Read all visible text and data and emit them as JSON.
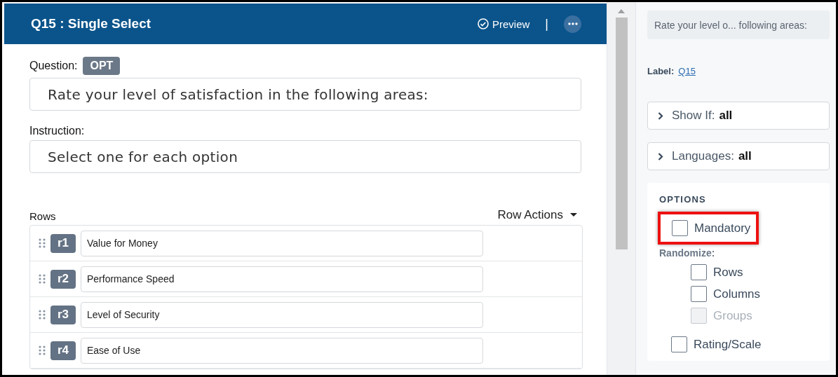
{
  "editor": {
    "title": "Q15 : Single Select",
    "preview": "Preview",
    "separator": "|",
    "question_label": "Question:",
    "question_badge": "OPT",
    "question_text": "Rate your level of satisfaction in the following areas:",
    "instruction_label": "Instruction:",
    "instruction_text": "Select one for each option",
    "rows_label": "Rows",
    "row_actions": "Row Actions",
    "rows": [
      {
        "code": "r1",
        "text": "Value for Money"
      },
      {
        "code": "r2",
        "text": "Performance Speed"
      },
      {
        "code": "r3",
        "text": "Level of Security"
      },
      {
        "code": "r4",
        "text": "Ease of Use"
      }
    ]
  },
  "sidebar": {
    "summary": "Rate your level o... following areas:",
    "label_key": "Label:",
    "label_value": "Q15",
    "sections": [
      {
        "label": "Show If:",
        "value": "all",
        "expanded": false
      },
      {
        "label": "Languages:",
        "value": "all",
        "expanded": false
      }
    ],
    "options": {
      "heading": "OPTIONS",
      "mandatory": {
        "label": "Mandatory",
        "checked": false,
        "highlighted": true
      },
      "randomize_label": "Randomize:",
      "randomize": [
        {
          "label": "Rows",
          "checked": false,
          "disabled": false
        },
        {
          "label": "Columns",
          "checked": false,
          "disabled": false
        },
        {
          "label": "Groups",
          "checked": false,
          "disabled": true
        }
      ],
      "rating": {
        "label": "Rating/Scale",
        "checked": false
      }
    }
  }
}
